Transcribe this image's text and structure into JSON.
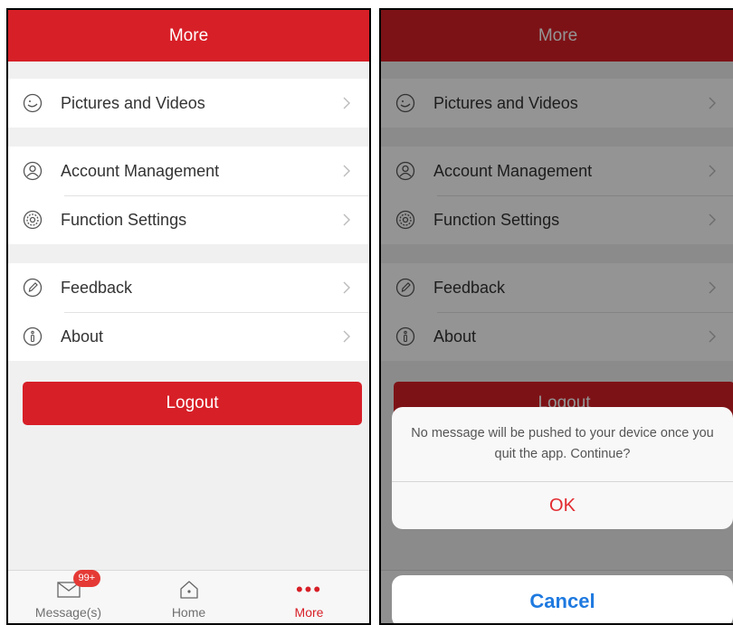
{
  "header": {
    "title": "More"
  },
  "menu": {
    "pictures": "Pictures and Videos",
    "account": "Account Management",
    "function": "Function Settings",
    "feedback": "Feedback",
    "about": "About"
  },
  "logout_label": "Logout",
  "tabs": {
    "messages": {
      "label": "Message(s)",
      "badge": "99+"
    },
    "home": {
      "label": "Home"
    },
    "more": {
      "label": "More",
      "icon": "•••"
    }
  },
  "dialog": {
    "message": "No message will be pushed to your device once you quit the app. Continue?",
    "ok": "OK",
    "cancel": "Cancel"
  },
  "colors": {
    "accent": "#d71f27",
    "cancel": "#1f7ae0"
  }
}
